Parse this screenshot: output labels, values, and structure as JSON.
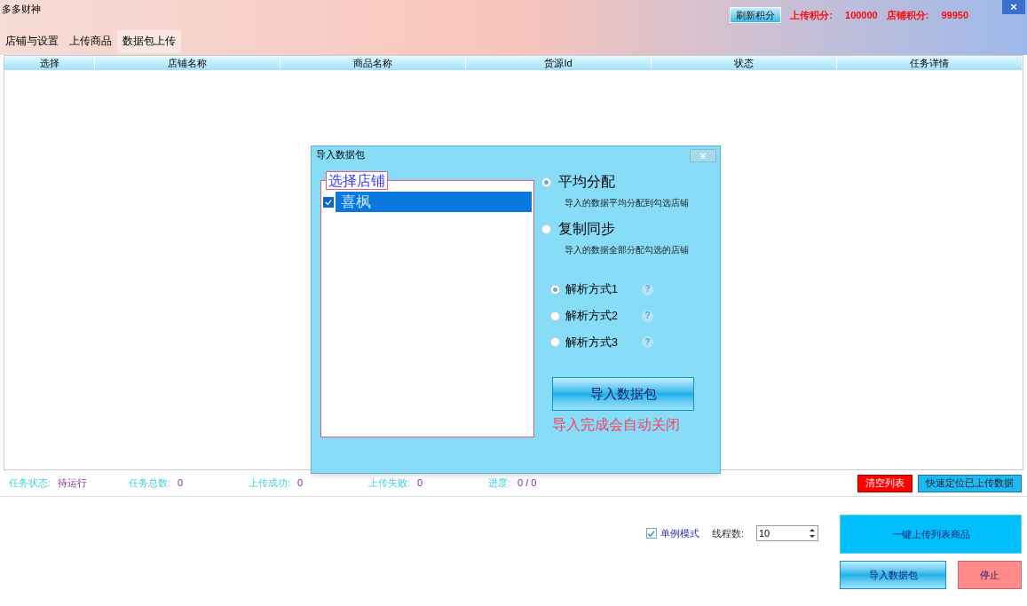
{
  "window": {
    "title": "多多财神",
    "close": "×"
  },
  "header": {
    "refresh_button": "刷新积分",
    "stats": [
      {
        "label": "上传积分:",
        "value": "100000"
      },
      {
        "label": "店铺积分:",
        "value": "99950"
      }
    ]
  },
  "tabs": [
    {
      "label": "店铺与设置",
      "selected": false
    },
    {
      "label": "上传商品",
      "selected": false
    },
    {
      "label": "数据包上传",
      "selected": true
    }
  ],
  "table": {
    "columns": [
      "选择",
      "店铺名称",
      "商品名称",
      "货源Id",
      "状态",
      "任务详情"
    ]
  },
  "status_bar": {
    "items": [
      {
        "label": "任务状态:",
        "value": "待运行"
      },
      {
        "label": "任务总数:",
        "value": "0"
      },
      {
        "label": "上传成功:",
        "value": "0"
      },
      {
        "label": "上传失败:",
        "value": "0"
      },
      {
        "label": "进度:",
        "value": "0 / 0"
      }
    ],
    "buttons": [
      {
        "label": "清空列表",
        "kind": "danger"
      },
      {
        "label": "快速定位已上传数据",
        "kind": "info"
      }
    ]
  },
  "controls": {
    "single_mode": {
      "label": "单例模式",
      "checked": true
    },
    "threads": {
      "label": "线程数:",
      "value": "10"
    },
    "buttons": [
      {
        "label": "一键上传列表商品",
        "kind": "primary"
      },
      {
        "label": "导入数据包",
        "kind": "gradient"
      },
      {
        "label": "停止",
        "kind": "stop"
      }
    ]
  },
  "dialog": {
    "title": "导入数据包",
    "close": "×",
    "group_title": "选择店铺",
    "shops": [
      {
        "name": "喜枫",
        "checked": true,
        "selected": true
      }
    ],
    "modes": [
      {
        "label": "平均分配",
        "description": "导入的数据平均分配到勾选店铺",
        "selected": true
      },
      {
        "label": "复制同步",
        "description": "导入的数据全部分配勾选的店铺",
        "selected": false
      }
    ],
    "parse_modes": [
      {
        "label": "解析方式1",
        "selected": true
      },
      {
        "label": "解析方式2",
        "selected": false
      },
      {
        "label": "解析方式3",
        "selected": false
      }
    ],
    "help": "?",
    "import_button": "导入数据包",
    "note": "导入完成会自动关闭"
  }
}
